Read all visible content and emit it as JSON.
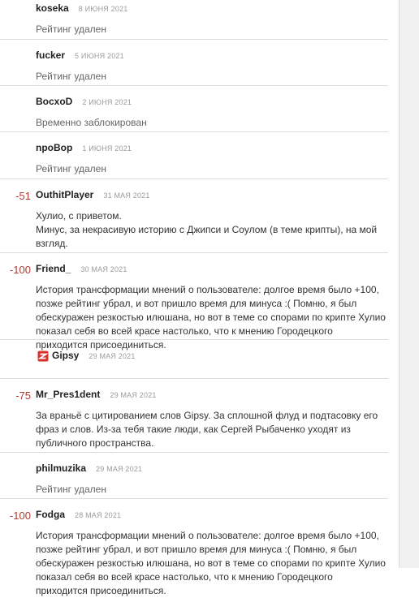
{
  "comments": [
    {
      "username": "koseka",
      "date": "8 ИЮНЯ 2021",
      "status": "Рейтинг удален"
    },
    {
      "username": "fucker",
      "date": "5 ИЮНЯ 2021",
      "status": "Рейтинг удален"
    },
    {
      "username": "BocxoD",
      "date": "2 ИЮНЯ 2021",
      "status": "Временно заблокирован"
    },
    {
      "username": "npoBop",
      "date": "1 ИЮНЯ 2021",
      "status": "Рейтинг удален"
    },
    {
      "rating": "-51",
      "username": "OuthitPlayer",
      "date": "31 МАЯ 2021",
      "text": "Хулио, с приветом.\nМинус, за некрасивую историю с Джипси и Соулом (в теме крипты), на мой взгляд."
    },
    {
      "rating": "-100",
      "username": "Friend_",
      "date": "30 МАЯ 2021",
      "text": "История трансформации мнений о пользователе: долгое время было +100, позже рейтинг убрал, и вот пришло время для минуса :( Помню, я был обескуражен резкостью илюшана, но вот в теме со спорами по крипте Хулио показал себя во всей красе настолько, что к мнению Городецкого приходится присоединиться."
    },
    {
      "username": "Gipsy",
      "date": "29 МАЯ 2021",
      "logo_icon": "gipsy-logo-icon"
    },
    {
      "rating": "-75",
      "username": "Mr_Pres1dent",
      "date": "29 МАЯ 2021",
      "text": "За враньё с цитированием слов Gipsy. За сплошной флуд и подтасовку его фраз и слов. Из-за тебя такие люди, как Сергей Рыбаченко уходят из публичного пространства."
    },
    {
      "username": "philmuzika",
      "date": "29 МАЯ 2021",
      "status": "Рейтинг удален"
    },
    {
      "rating": "-100",
      "username": "Fodga",
      "date": "28 МАЯ 2021",
      "text": "История трансформации мнений о пользователе: долгое время было +100, позже рейтинг убрал, и вот пришло время для минуса :( Помню, я был обескуражен резкостью илюшана, но вот в теме со спорами по крипте Хулио показал себя во всей красе настолько, что к мнению Городецкого приходится присоединиться."
    }
  ],
  "colors": {
    "rating": "#b03a2e",
    "divider": "#dcdcdc",
    "logo": "#d8332a"
  }
}
